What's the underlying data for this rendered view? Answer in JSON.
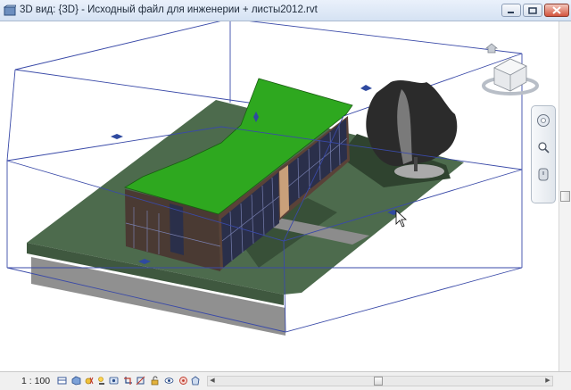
{
  "window": {
    "title": "3D вид: {3D} - Исходный файл для инженерии + листы2012.rvt"
  },
  "viewcube": {
    "face_label": "",
    "icons": [
      "viewcube-icon",
      "home-icon"
    ]
  },
  "nav_bar": {
    "tools": [
      "steering-wheel-icon",
      "zoom-icon",
      "orbit-icon"
    ]
  },
  "status_bar": {
    "scale": "1 : 100",
    "icons": [
      "detail-level-icon",
      "visual-style-icon",
      "sun-path-icon",
      "shadows-icon",
      "show-rendering-icon",
      "crop-view-icon",
      "show-crop-icon",
      "unlock-3d-view-icon",
      "temporary-hide-icon",
      "reveal-hidden-icon",
      "analytical-model-icon",
      "highlight-displacement-icon"
    ]
  },
  "colors": {
    "ground": "#4b6a4b",
    "roof": "#2ea81f",
    "wall": "#5a4238",
    "glass": "#2a2f4a",
    "section_box": "#3a4aa8"
  }
}
